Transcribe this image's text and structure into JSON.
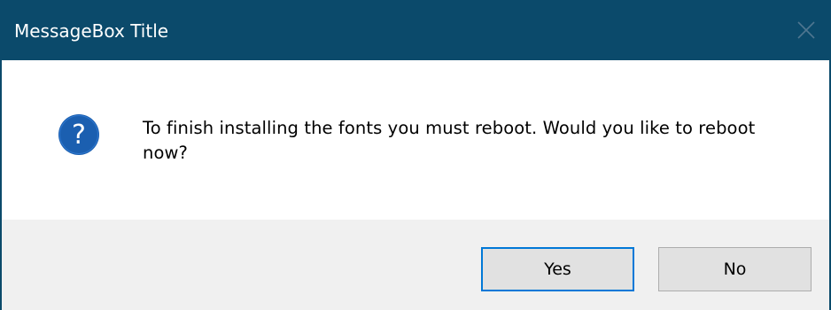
{
  "window": {
    "title": "MessageBox Title",
    "titlebar_color": "#0b4a6b",
    "close_icon": "close-icon"
  },
  "message": {
    "icon": "question-icon",
    "icon_color": "#1b5fb0",
    "text": "To finish installing the fonts you must reboot.  Would you like to reboot now?"
  },
  "buttons": {
    "yes_label": "Yes",
    "no_label": "No",
    "default_button": "Yes",
    "focus_color": "#0078d7"
  }
}
